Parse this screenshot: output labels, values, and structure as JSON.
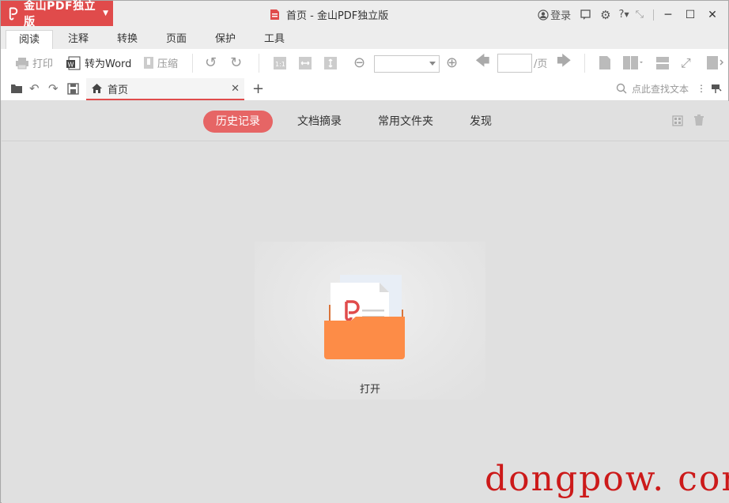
{
  "app": {
    "name": "金山PDF独立版",
    "window_title": "首页 - 金山PDF独立版",
    "brand_color": "#e04b4b"
  },
  "titlebar": {
    "login": "登录",
    "help": "?"
  },
  "menu_tabs": [
    "阅读",
    "注释",
    "转换",
    "页面",
    "保护",
    "工具"
  ],
  "active_menu_tab": "阅读",
  "toolbar": {
    "print": "打印",
    "to_word": "转为Word",
    "compress": "压缩",
    "page_value": "",
    "page_suffix": "/页",
    "zoom_value": ""
  },
  "tabs": [
    {
      "label": "首页",
      "active": true
    }
  ],
  "search": {
    "placeholder": "点此查找文本"
  },
  "home": {
    "nav": [
      "历史记录",
      "文档摘录",
      "常用文件夹",
      "发现"
    ],
    "active_nav": "历史记录",
    "open_label": "打开"
  },
  "watermark": "dongpow. com",
  "icons": [
    "app-logo-icon",
    "document-icon",
    "user-icon",
    "feedback-icon",
    "settings-icon",
    "help-icon",
    "shrink-icon",
    "minimize-icon",
    "maximize-icon",
    "close-icon",
    "print-icon",
    "word-icon",
    "compress-icon",
    "rotate-left-icon",
    "rotate-right-icon",
    "actual-size-icon",
    "fit-width-icon",
    "fit-page-icon",
    "zoom-out-icon",
    "zoom-in-icon",
    "prev-page-icon",
    "next-page-icon",
    "single-page-icon",
    "double-page-icon",
    "continuous-icon",
    "fullscreen-icon",
    "open-folder-icon",
    "undo-icon",
    "redo-icon",
    "save-icon",
    "home-icon",
    "search-icon",
    "more-icon",
    "grid-view-icon",
    "clear-icon",
    "folder-open-illustration"
  ]
}
